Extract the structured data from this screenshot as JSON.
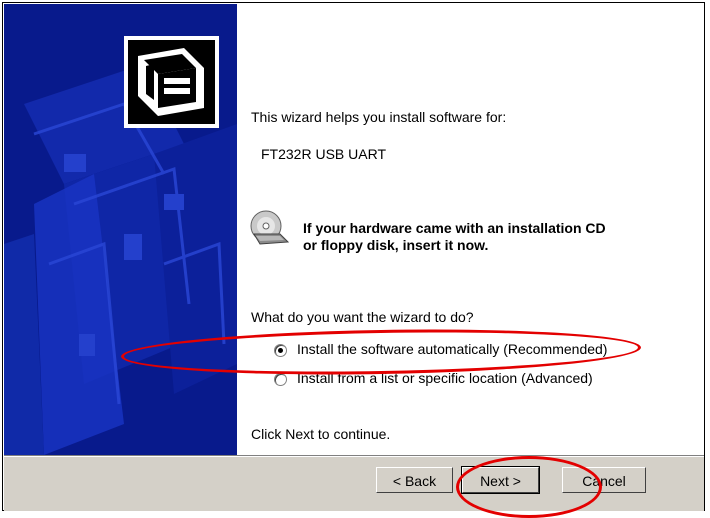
{
  "wizard": {
    "intro": "This wizard helps you install software for:",
    "device": "FT232R USB UART",
    "cd_prompt_line1": "If your hardware came with an installation CD",
    "cd_prompt_line2": "or floppy disk, insert it now.",
    "question": "What do you want the wizard to do?",
    "options": [
      {
        "label": "Install the software automatically (Recommended)",
        "checked": true
      },
      {
        "label": "Install from a list or specific location (Advanced)",
        "checked": false
      }
    ],
    "continue_text": "Click Next to continue."
  },
  "buttons": {
    "back": "< Back",
    "next": "Next >",
    "cancel": "Cancel"
  },
  "colors": {
    "banner": "#081a8c",
    "annotation": "#e30000"
  },
  "icons": [
    "hardware-wizard-icon",
    "cd-icon"
  ]
}
